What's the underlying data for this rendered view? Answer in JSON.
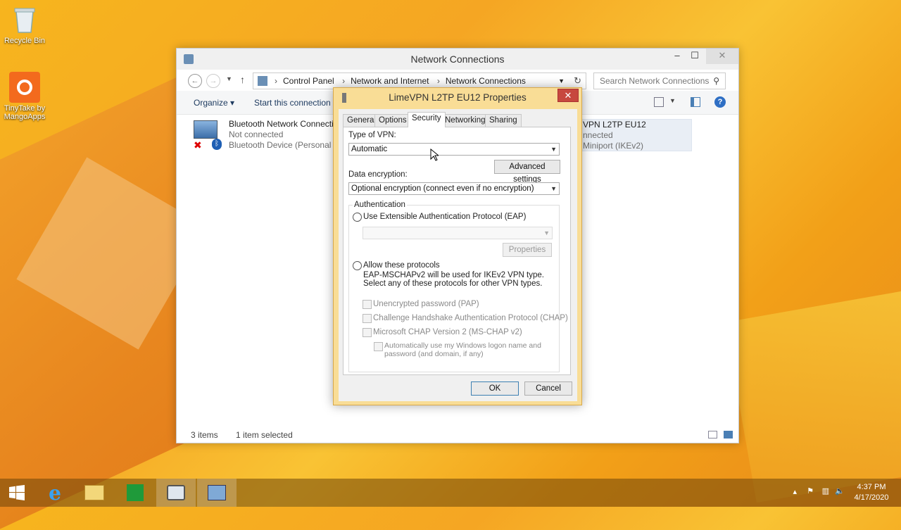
{
  "desktop": {
    "icons": [
      {
        "label": "Recycle Bin"
      },
      {
        "label": "TinyTake by MangoApps"
      }
    ]
  },
  "explorer": {
    "title": "Network Connections",
    "controls": {
      "minimize": "–",
      "maximize": "☐",
      "close": "✕"
    },
    "breadcrumb": [
      "Control Panel",
      "Network and Internet",
      "Network Connections"
    ],
    "search_placeholder": "Search Network Connections",
    "toolbar": {
      "organize": "Organize ▾",
      "start_connection": "Start this connection"
    },
    "items": [
      {
        "name": "Bluetooth Network Connection",
        "status": "Not connected",
        "device": "Bluetooth Device (Personal Ar"
      },
      {
        "name": "VPN L2TP EU12",
        "status": "nnected",
        "device": "Miniport (IKEv2)"
      }
    ],
    "status_bar": {
      "count": "3 items",
      "selected": "1 item selected"
    }
  },
  "dialog": {
    "title": "LimeVPN L2TP EU12 Properties",
    "close": "✕",
    "tabs": [
      "General",
      "Options",
      "Security",
      "Networking",
      "Sharing"
    ],
    "active_tab": "Security",
    "vpn_type_label": "Type of VPN:",
    "vpn_type_value": "Automatic",
    "advanced_settings": "Advanced settings",
    "encryption_label": "Data encryption:",
    "encryption_value": "Optional encryption (connect even if no encryption)",
    "auth_group_label": "Authentication",
    "eap_option": "Use Extensible Authentication Protocol (EAP)",
    "properties_button": "Properties",
    "allow_protocols_option": "Allow these protocols",
    "protocols_note": "EAP-MSCHAPv2 will be used for IKEv2 VPN type. Select any of these protocols for other VPN types.",
    "protocols": [
      "Unencrypted password (PAP)",
      "Challenge Handshake Authentication Protocol (CHAP)",
      "Microsoft CHAP Version 2 (MS-CHAP v2)"
    ],
    "auto_logon": "Automatically use my Windows logon name and password (and domain, if any)",
    "ok": "OK",
    "cancel": "Cancel"
  },
  "taskbar": {
    "clock_time": "4:37 PM",
    "clock_date": "4/17/2020"
  }
}
